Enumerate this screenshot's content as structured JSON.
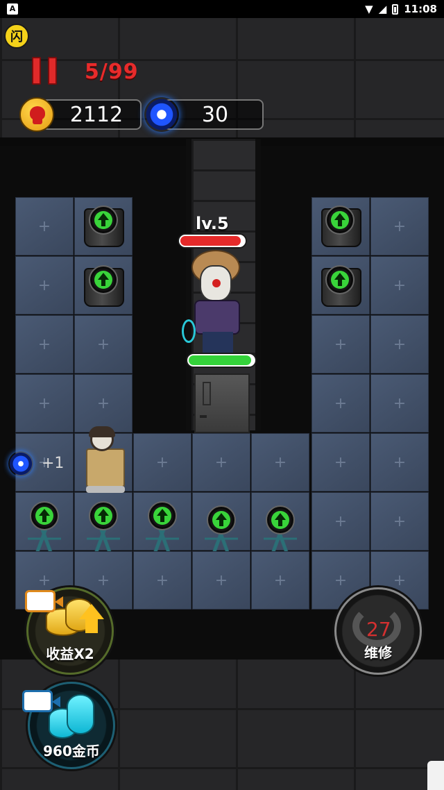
{
  "status_bar": {
    "app_glyph": "A",
    "time": "11:08"
  },
  "game_logo": "闪",
  "wave": "5/99",
  "resources": {
    "coins": "2112",
    "orbs": "30"
  },
  "enemy": {
    "level": "lv.5",
    "health": 0.95,
    "shield": 0.96
  },
  "income_popup": "+1",
  "buttons": {
    "double_income": "收益X2",
    "repair": "维修",
    "repair_count": "27",
    "coins_reward": "960金币"
  },
  "colors": {
    "wave_red": "#e82b2b",
    "health_red": "#e52a2a",
    "shield_green": "#34d23a",
    "upgrade_green": "#39d43a",
    "tile_blue": "#4a5a74"
  }
}
